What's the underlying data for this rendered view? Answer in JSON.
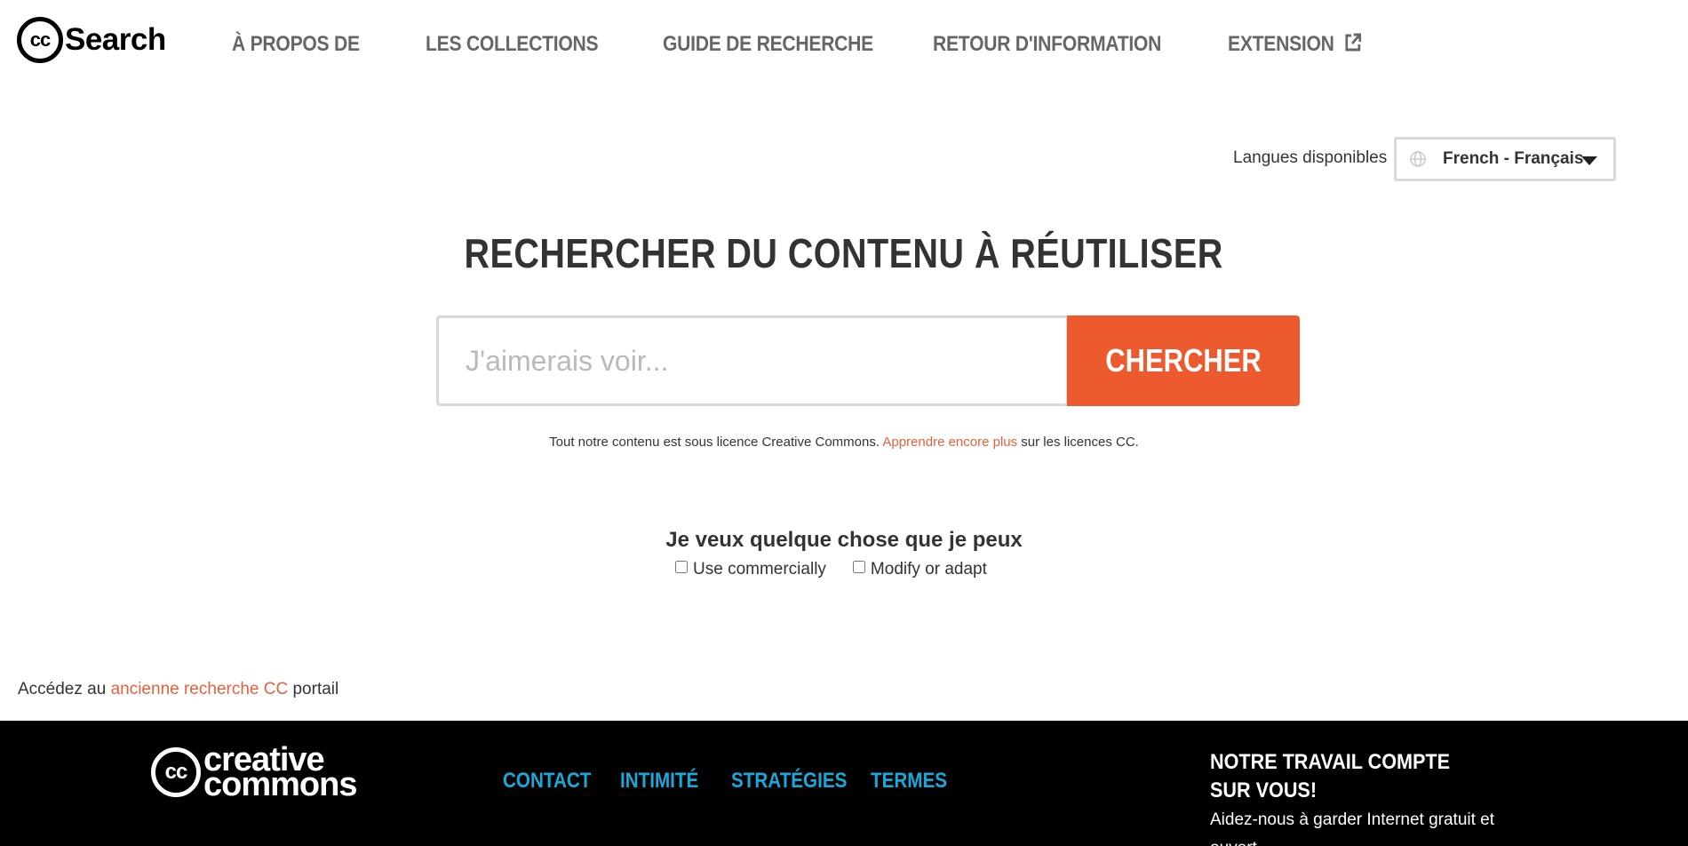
{
  "header": {
    "logo_mark": "cc",
    "logo_text": "Search",
    "nav": [
      {
        "label": "À PROPOS DE"
      },
      {
        "label": "LES COLLECTIONS"
      },
      {
        "label": "GUIDE DE RECHERCHE"
      },
      {
        "label": "RETOUR D'INFORMATION"
      },
      {
        "label": "EXTENSION",
        "icon": "external-link-icon"
      }
    ]
  },
  "language": {
    "label": "Langues disponibles",
    "selected": "French - Français",
    "icon": "globe-icon"
  },
  "hero": {
    "title": "RECHERCHER DU CONTENU À RÉUTILISER",
    "search_placeholder": "J'aimerais voir...",
    "search_value": "",
    "search_button": "CHERCHER",
    "license_prefix": "Tout notre contenu est sous licence Creative Commons.",
    "license_link": "Apprendre encore plus",
    "license_suffix": "sur les licences CC."
  },
  "filters": {
    "title": "Je veux quelque chose que je peux",
    "options": [
      {
        "label": "Use commercially",
        "checked": false
      },
      {
        "label": "Modify or adapt",
        "checked": false
      }
    ]
  },
  "legacy": {
    "prefix": "Accédez au",
    "link": "ancienne recherche CC",
    "suffix": "portail"
  },
  "footer": {
    "logo_mark": "cc",
    "logo_line1": "creative",
    "logo_line2": "commons",
    "links": [
      {
        "label": "CONTACT"
      },
      {
        "label": "INTIMITÉ"
      },
      {
        "label": "STRATÉGIES"
      },
      {
        "label": "TERMES"
      }
    ],
    "donate_title": "NOTRE TRAVAIL COMPTE SUR VOUS!",
    "donate_text": "Aidez-nous à garder Internet gratuit et ouvert."
  },
  "colors": {
    "accent": "#ec5a2e",
    "link": "#e8603a",
    "footer_link": "#1aa8d8",
    "footer_bg": "#000000"
  }
}
